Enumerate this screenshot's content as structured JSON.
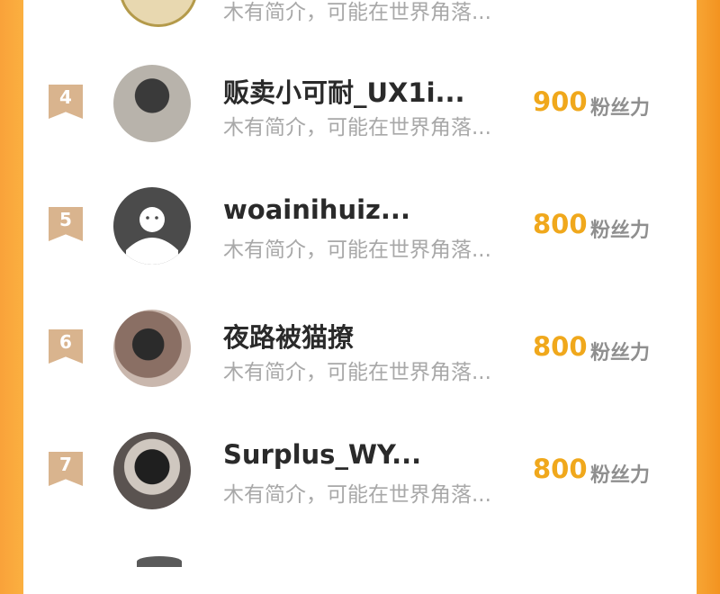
{
  "top_partial": {
    "bio": "木有简介，可能在世界角落..."
  },
  "rows": [
    {
      "rank": "4",
      "name": "贩卖小可耐_UX1i...",
      "bio": "木有简介，可能在世界角落...",
      "score": "900",
      "unit": "粉丝力"
    },
    {
      "rank": "5",
      "name": "woainihuiz...",
      "bio": "木有简介，可能在世界角落...",
      "score": "800",
      "unit": "粉丝力"
    },
    {
      "rank": "6",
      "name": "夜路被猫撩",
      "bio": "木有简介，可能在世界角落...",
      "score": "800",
      "unit": "粉丝力"
    },
    {
      "rank": "7",
      "name": "Surplus_WY...",
      "bio": "木有简介，可能在世界角落...",
      "score": "800",
      "unit": "粉丝力"
    }
  ],
  "colors": {
    "accent": "#f0a81c",
    "rank_badge": "#d9b48e",
    "background": "#f9a23a"
  }
}
